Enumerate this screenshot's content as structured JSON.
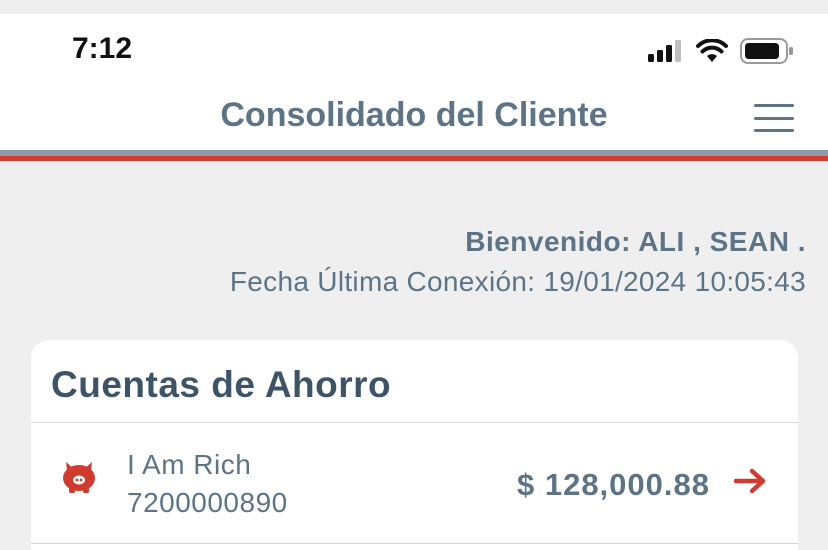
{
  "status_bar": {
    "time": "7:12",
    "icons": [
      "signal-icon",
      "wifi-icon",
      "battery-icon"
    ]
  },
  "header": {
    "title": "Consolidado del Cliente",
    "menu_icon": "hamburger-menu-icon"
  },
  "colors": {
    "accent_red": "#d13b2f",
    "text_slate": "#5d7487",
    "title_dark": "#3d5468"
  },
  "welcome": {
    "greeting": "Bienvenido: ALI , SEAN .",
    "last_connection": "Fecha Última Conexión: 19/01/2024 10:05:43"
  },
  "savings": {
    "title": "Cuentas de Ahorro",
    "accounts": [
      {
        "name": "I Am Rich",
        "number": "7200000890",
        "balance": "$ 128,000.88",
        "icon": "piggy-bank-icon"
      }
    ]
  }
}
